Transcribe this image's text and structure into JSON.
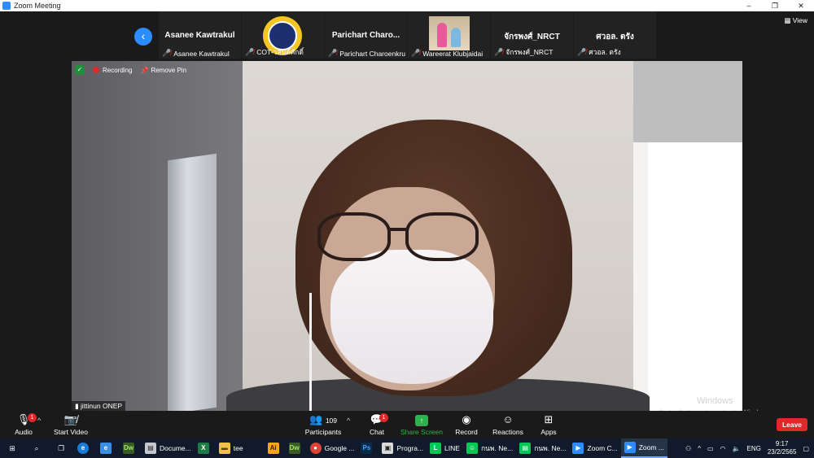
{
  "window": {
    "title": "Zoom Meeting",
    "controls": [
      "–",
      "❐",
      "✕"
    ]
  },
  "strip": {
    "view_label": "View",
    "tiles": [
      {
        "display": "Asanee Kawtrakul",
        "label": "Asanee Kawtrakul",
        "kind": "name"
      },
      {
        "display": "",
        "label": "COT-วสันต์ศักดิ์",
        "kind": "logo"
      },
      {
        "display": "Parichart  Charo...",
        "label": "Parichart Charoenkru...",
        "kind": "name"
      },
      {
        "display": "",
        "label": "Wareerat Klubjaidai",
        "kind": "photo"
      },
      {
        "display": "จักรพงศ์_NRCT",
        "label": "จักรพงศ์_NRCT",
        "kind": "name"
      },
      {
        "display": "ศวอล. ตรัง",
        "label": "ศวอล. ตรัง",
        "kind": "name"
      }
    ]
  },
  "video": {
    "recording_label": "Recording",
    "remove_pin_label": "Remove Pin",
    "speaker_name": "jittinun ONEP"
  },
  "watermark": {
    "line1": "Windows",
    "line2": "Go to Settings to activate Windows."
  },
  "toolbar": {
    "audio": "Audio",
    "start_video": "Start Video",
    "participants": "Participants",
    "participants_count": "109",
    "chat": "Chat",
    "chat_badge": "1",
    "audio_badge": "1",
    "share_screen": "Share Screen",
    "record": "Record",
    "reactions": "Reactions",
    "apps": "Apps",
    "leave": "Leave"
  },
  "taskbar": {
    "items": [
      {
        "label": "Docume...",
        "icon": "doc-icon"
      },
      {
        "label": "",
        "icon": "excel-icon"
      },
      {
        "label": "tee",
        "icon": "folder-icon"
      },
      {
        "label": "",
        "icon": "illustrator-icon"
      },
      {
        "label": "",
        "icon": "dreamweaver-icon"
      },
      {
        "label": "Google ...",
        "icon": "chrome-icon"
      },
      {
        "label": "",
        "icon": "photoshop-icon"
      },
      {
        "label": "Progra...",
        "icon": "app-icon"
      },
      {
        "label": "LINE",
        "icon": "line-icon"
      },
      {
        "label": "กนพ. Ne...",
        "icon": "users-icon"
      },
      {
        "label": "กนพ. Ne...",
        "icon": "sheet-icon"
      },
      {
        "label": "Zoom C...",
        "icon": "zoom-icon"
      },
      {
        "label": "Zoom ...",
        "icon": "zoom-icon"
      }
    ],
    "lang": "ENG",
    "time": "9:17",
    "date": "23/2/2565"
  },
  "colors": {
    "zoom_blue": "#2d8cff",
    "leave_red": "#e02828",
    "share_green": "#2fb24c",
    "taskbar": "#101a2b"
  }
}
